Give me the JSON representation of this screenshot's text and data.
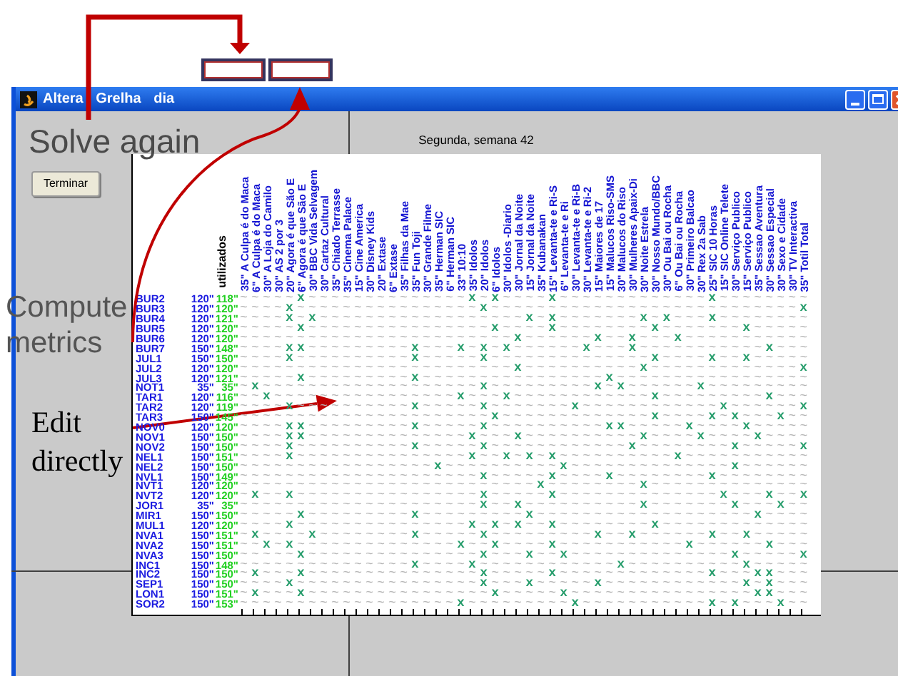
{
  "annotations": {
    "solve_again": "Solve again",
    "compute_metrics": "Compute metrics",
    "edit_directly": "Edit directly"
  },
  "window": {
    "title": "Altera Grelha dia"
  },
  "button": "Terminar",
  "subtitle": "Segunda, semana 42",
  "grid": {
    "used_header": "utilizados",
    "columns": [
      "35\" A Culpa é do Maca",
      "6\" A Culpa é do Maca",
      "30\" A Loja do Camilo",
      "30\" AS 2 por 3",
      "20\" Agora é que São E",
      "6\" Agora é que São E",
      "30\" BBC Vida Selvagem",
      "30\" Cartaz Cultural",
      "35\" Chiado Terrasse",
      "35\" Cinema Palace",
      "15\" Cine America",
      "30\" Disney Kids",
      "20\" Extase",
      "6\" Extase",
      "35\" Filhas da Mae",
      "35\" Fun Toji",
      "30\" Grande Filme",
      "35\" Herman SIC",
      "6\" Herman SIC",
      "33\" 10:10",
      "35\" Idolos",
      "20\" Idolos",
      "6\" Idolos",
      "30\" Idolos -Diario",
      "30\" Jornal da Noite",
      "15\" Jornal da Noite",
      "35\" Kubanakan",
      "15\" Levanta-te e Ri-S",
      "6\" Levanta-te e Ri",
      "30\" Levanta-te e Ri-B",
      "30\" Levanta-te e Ri-2",
      "15\" Maiores de 17",
      "15\" Malucos Riso-SMS",
      "30\" Malucos do Riso",
      "30\" Mulheres Apaix-Di",
      "30\" Noite Estrela",
      "30\" Nosso Mundo/BBC",
      "30\" Ou Bai ou Rocha",
      "6\" Ou Bai ou Rocha",
      "30\" Primeiro Balcao",
      "30\" Rex 2a Sab",
      "25\" SIC 10 Horas",
      "15\" SIC Online Telete",
      "30\" Serviço Publico",
      "15\" Serviço Publico",
      "35\" Sessao Aventura",
      "30\" Sessao Especial",
      "30\" Sexo e Cidade",
      "30\" TV Interactiva",
      "35\" Totil Total"
    ],
    "rows": [
      {
        "name": "BUR2",
        "target": "120\"",
        "used": "118\"",
        "marks": [
          "~~~~~",
          "x",
          "~~~~~~~~~~~~~~",
          "x",
          "~",
          "x",
          "~~~~",
          "x",
          "~~~~~~~~~~~~~",
          "x",
          "~~~~~~~~"
        ]
      },
      {
        "name": "BUR3",
        "target": "120\"",
        "used": "120\"",
        "marks": [
          "~~~~",
          "x",
          "~~~~~~~~~~~~~~~~",
          "x",
          "~~~~~~~~~~~~~~~~~~~~~~~~~~~",
          "x"
        ]
      },
      {
        "name": "BUR4",
        "target": "120\"",
        "used": "121\"",
        "marks": [
          "~~~~",
          "x",
          "~",
          "x",
          "~~~~~~~~~~~~~~~~~~",
          "x",
          "~",
          "x",
          "~~~~~~~",
          "x",
          "~",
          "x",
          "~~~",
          "x",
          "~~~~~~~~"
        ]
      },
      {
        "name": "BUR5",
        "target": "120\"",
        "used": "120\"",
        "marks": [
          "~~~~~",
          "x",
          "~~~~~~~~~~~~~~~~",
          "x",
          "~~~~",
          "x",
          "~~~~~~~~",
          "x",
          "~~~~~~~",
          "x",
          "~~~~~"
        ]
      },
      {
        "name": "BUR6",
        "target": "120\"",
        "used": "120\"",
        "marks": [
          "~~~~~~~~~~~~~~~~~~~~~~~~",
          "x",
          "~~~~~~",
          "x",
          "~~",
          "x",
          "~~~",
          "x",
          "~~~~~~~~~~~"
        ]
      },
      {
        "name": "BUR7",
        "target": "150\"",
        "used": "148\"",
        "marks": [
          "~~~~",
          "xx",
          "~~~~~~~~~",
          "x",
          "~~~",
          "x",
          "~",
          "x",
          "~",
          "x",
          "~~~~~~",
          "x",
          "~~~",
          "x",
          "~~~~~~~~~~~",
          "x",
          "~~~"
        ]
      },
      {
        "name": "JUL1",
        "target": "150\"",
        "used": "150\"",
        "marks": [
          "~~~~",
          "x",
          "~~~~~~~~~~",
          "x",
          "~~~~~",
          "x",
          "~~~~~~~~~~~~~~",
          "x",
          "~~~~",
          "x",
          "~~",
          "x",
          "~~~~~"
        ]
      },
      {
        "name": "JUL2",
        "target": "120\"",
        "used": "120\"",
        "marks": [
          "~~~~~~~~~~~~~~~~~~~~~~~~",
          "x",
          "~~~~~~~~~~",
          "x",
          "~~~~~~~~~~~~~",
          "x"
        ]
      },
      {
        "name": "JUL3",
        "target": "120\"",
        "used": "121\"",
        "marks": [
          "~~~~~",
          "x",
          "~~~~~~~~~",
          "x",
          "~~~~~~~~~~~~~~~~",
          "x",
          "~~~~~~~~~~~~~~~~~"
        ]
      },
      {
        "name": "NOT1",
        "target": "35\"",
        "used": "35\"",
        "marks": [
          "~",
          "x",
          "~~~~~~~~~~~~~~~~~~~",
          "x",
          "~~~~~~~~~",
          "x",
          "~",
          "x",
          "~~~~~~",
          "x",
          "~~~~~~~~~"
        ]
      },
      {
        "name": "TAR1",
        "target": "120\"",
        "used": "116\"",
        "marks": [
          "~~",
          "x",
          "~~~~~~~~~~~~~~~~",
          "x",
          "~~~",
          "x",
          "~~~~~~~~~~~~",
          "x",
          "~~~~~~~~~",
          "x",
          "~~~"
        ]
      },
      {
        "name": "TAR2",
        "target": "120\"",
        "used": "119\"",
        "marks": [
          "~~~~",
          "x",
          "~~~~~~~~~~",
          "x",
          "~~~~~",
          "x",
          "~~~~~~~",
          "x",
          "~~~~~~~~~~~~",
          "x",
          "~~~~~~",
          "x"
        ]
      },
      {
        "name": "TAR3",
        "target": "150\"",
        "used": "145\"",
        "marks": [
          "~~~~~~~~~~~~~~~~~~~~~~",
          "x",
          "~~~~~~~~~~~~~",
          "x",
          "~~~~",
          "x",
          "~",
          "x",
          "~~~",
          "x",
          "~~"
        ]
      },
      {
        "name": "NOV0",
        "target": "120\"",
        "used": "120\"",
        "marks": [
          "~~~~",
          "xx",
          "~~~~~~~~~",
          "x",
          "~~~~~",
          "x",
          "~~~~~~~~~~",
          "xx",
          "~~~~~",
          "x",
          "~~~~",
          "x",
          "~~~~~"
        ]
      },
      {
        "name": "NOV1",
        "target": "150\"",
        "used": "150\"",
        "marks": [
          "~~~~",
          "xx",
          "~~~~~~~~~~~~~~",
          "x",
          "~~~",
          "x",
          "~~~~~~~~~~",
          "x",
          "~~~~",
          "x",
          "~~~~",
          "x",
          "~~~~"
        ]
      },
      {
        "name": "NOV2",
        "target": "150\"",
        "used": "150\"",
        "marks": [
          "~~~~",
          "x",
          "~~~~~~~~~~",
          "x",
          "~~~~~",
          "x",
          "~~~~~~~~~~~~",
          "x",
          "~~~~~~~~",
          "x",
          "~~~~~",
          "x"
        ]
      },
      {
        "name": "NEL1",
        "target": "150\"",
        "used": "151\"",
        "marks": [
          "~~~~",
          "x",
          "~~~~~~~~~~~~~~~",
          "x",
          "~~",
          "x",
          "~",
          "x",
          "~",
          "x",
          "~~~~~~~~~~",
          "x",
          "~~~~~~~~~~~"
        ]
      },
      {
        "name": "NEL2",
        "target": "150\"",
        "used": "150\"",
        "marks": [
          "~~~~~~~~~~~~~~~~~",
          "x",
          "~~~~~~~~~~",
          "x",
          "~~~~~~~~~~~~~~",
          "x",
          "~~~~~~"
        ]
      },
      {
        "name": "NVL1",
        "target": "150\"",
        "used": "149\"",
        "marks": [
          "~~~~~~~~~~~~~~~~~~~~~",
          "x",
          "~~~~~",
          "x",
          "~~~~",
          "x",
          "~~~~~~~~",
          "x",
          "~~~~~~~~"
        ]
      },
      {
        "name": "NVT1",
        "target": "120\"",
        "used": "120\"",
        "marks": [
          "~~~~~~~~~~~~~~~~~~~~~~~~~~",
          "x",
          "~~~~~~~~",
          "x",
          "~~~~~~~~~~~~~~"
        ]
      },
      {
        "name": "NVT2",
        "target": "120\"",
        "used": "120\"",
        "marks": [
          "~",
          "x",
          "~~",
          "x",
          "~~~~~~~~~~~~~~~~",
          "x",
          "~~~~~",
          "x",
          "~~~~~~~~~~~~~~",
          "x",
          "~~~",
          "x",
          "~~",
          "x"
        ]
      },
      {
        "name": "JOR1",
        "target": "35\"",
        "used": "35\"",
        "marks": [
          "~~~~~~~~~~~~~~~~~~~~~",
          "x",
          "~~",
          "x",
          "~~~~~~~~~~",
          "x",
          "~~~~~~~",
          "x",
          "~~~",
          "x",
          "~~"
        ]
      },
      {
        "name": "MIR1",
        "target": "150\"",
        "used": "150\"",
        "marks": [
          "~~~~~",
          "x",
          "~~~~~~~~~",
          "x",
          "~~~~~~~~~",
          "x",
          "~~~~~~~~~~~~~~~~~~~",
          "x",
          "~~~~"
        ]
      },
      {
        "name": "MUL1",
        "target": "120\"",
        "used": "120\"",
        "marks": [
          "~~~~",
          "x",
          "~~~~~~~~~~~~~~~",
          "x",
          "~",
          "x",
          "~",
          "x",
          "~~",
          "x",
          "~~~~~~~~",
          "x",
          "~~~~~~~~~~~~~"
        ]
      },
      {
        "name": "NVA1",
        "target": "150\"",
        "used": "151\"",
        "marks": [
          "~",
          "x",
          "~~~~",
          "x",
          "~~~~~~~~",
          "x",
          "~~~~~",
          "x",
          "~~~~~~~~~",
          "x",
          "~~",
          "x",
          "~~~~~~",
          "x",
          "~~",
          "x",
          "~~~~~"
        ]
      },
      {
        "name": "NVA2",
        "target": "150\"",
        "used": "151\"",
        "marks": [
          "~~",
          "x",
          "~",
          "x",
          "~~~~~~~~~~~~~~",
          "x",
          "~~",
          "x",
          "~~~~",
          "x",
          "~~~~~~~~~~~",
          "x",
          "~~~~~~",
          "x",
          "~~~"
        ]
      },
      {
        "name": "NVA3",
        "target": "150\"",
        "used": "150\"",
        "marks": [
          "~~~~~",
          "x",
          "~~~~~~~~~~~~~~~",
          "x",
          "~~~",
          "x",
          "~~",
          "x",
          "~~~~~~~~~~~~~~",
          "x",
          "~~~~~",
          "x"
        ]
      },
      {
        "name": "INC1",
        "target": "150\"",
        "used": "148\"",
        "marks": [
          "~~~~~~~~~~~~~~~",
          "x",
          "~~~~",
          "x",
          "~~~~~~~~~~~~",
          "x",
          "~~~~~~~~~~",
          "x",
          "~~~~~"
        ]
      },
      {
        "name": "INC2",
        "target": "150\"",
        "used": "150\"",
        "marks": [
          "~",
          "x",
          "~~~",
          "x",
          "~~~~~~~~~~~~~~~",
          "x",
          "~~~~~",
          "x",
          "~~~~~~~~~~~~~",
          "x",
          "~~~",
          "xx",
          "~~~"
        ]
      },
      {
        "name": "SEP1",
        "target": "150\"",
        "used": "150\"",
        "marks": [
          "~~~~",
          "x",
          "~~~~~~~~~~~~~~~~",
          "x",
          "~~~",
          "x",
          "~~~~~",
          "x",
          "~~~~~~~~~~~~",
          "x",
          "~",
          "x",
          "~~~"
        ]
      },
      {
        "name": "LON1",
        "target": "150\"",
        "used": "151\"",
        "marks": [
          "~",
          "x",
          "~~~",
          "x",
          "~~~~~~~~~~~~~~~~",
          "x",
          "~~~~~",
          "x",
          "~~~~~~~~~~~~~~~~",
          "xx",
          "~~~"
        ]
      },
      {
        "name": "SOR2",
        "target": "150\"",
        "used": "153\"",
        "marks": [
          "~~~~~~~~~~~~~~~~~~~",
          "x",
          "~~~~~~~~~",
          "x",
          "~~~~~~~~~~~",
          "x",
          "~",
          "x",
          "~~~",
          "x",
          "~~"
        ]
      }
    ]
  }
}
